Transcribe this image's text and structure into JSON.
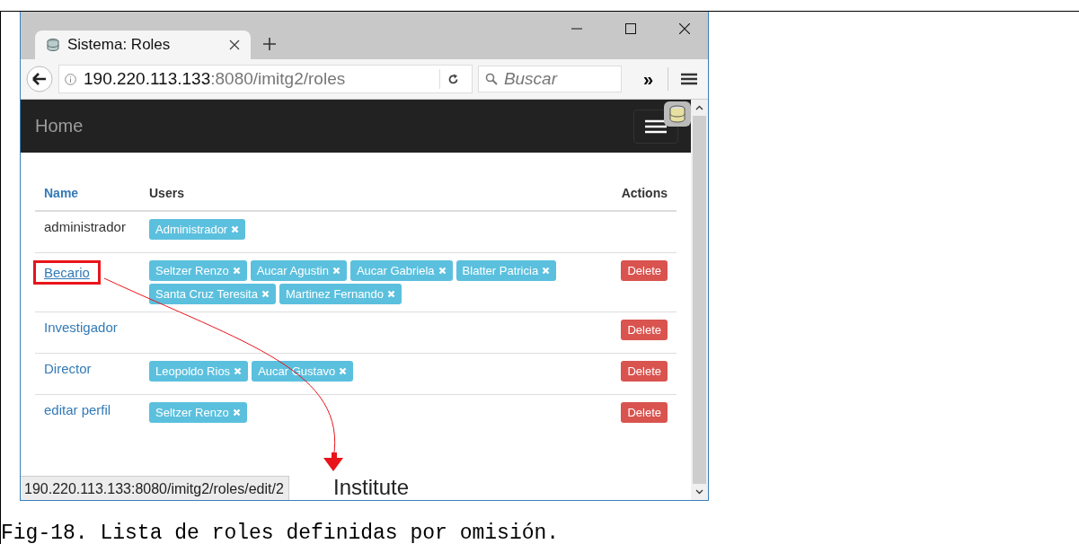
{
  "tab": {
    "title": "Sistema: Roles",
    "selected": true
  },
  "address": {
    "host": "190.220.113.133",
    "path": ":8080/imitg2/roles"
  },
  "search": {
    "placeholder": "Buscar"
  },
  "overflow_button": "»",
  "navbar": {
    "brand": "Home"
  },
  "table": {
    "columns": [
      {
        "label": "Name",
        "sortable": true
      },
      {
        "label": "Users",
        "sortable": false
      },
      {
        "label": "Actions",
        "sortable": false
      }
    ],
    "rows": [
      {
        "name": "administrador",
        "link": false,
        "highlighted": false,
        "users": [
          "Administrador"
        ]
      },
      {
        "name": "Becario",
        "link": true,
        "highlighted": true,
        "users": [
          "Seltzer Renzo",
          "Aucar Agustin",
          "Aucar Gabriela",
          "Blatter Patricia",
          "Santa Cruz Teresita",
          "Martinez Fernando"
        ],
        "action": "Delete"
      },
      {
        "name": "Investigador",
        "link": true,
        "highlighted": false,
        "users": [],
        "action": "Delete"
      },
      {
        "name": "Director",
        "link": true,
        "highlighted": false,
        "users": [
          "Leopoldo Rios",
          "Aucar Gustavo"
        ],
        "action": "Delete"
      },
      {
        "name": "editar perfil",
        "link": true,
        "highlighted": false,
        "users": [
          "Seltzer Renzo"
        ],
        "action": "Delete"
      }
    ]
  },
  "page_text": "Institute",
  "status_url": "190.220.113.133:8080/imitg2/roles/edit/2",
  "caption": "Fig-18. Lista de roles definidas por omisión."
}
